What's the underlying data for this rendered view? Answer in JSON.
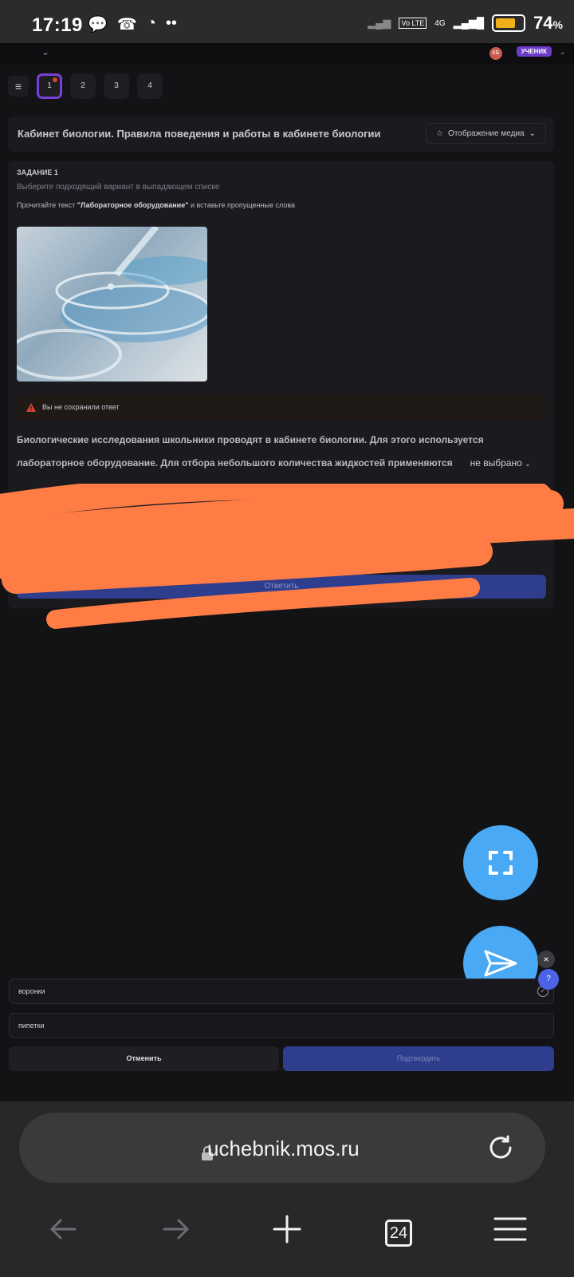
{
  "status_bar": {
    "time": "17:19",
    "battery": "74",
    "battery_unit": "%",
    "battery_level": 0.74,
    "network": "4G",
    "lte": "Vo LTE"
  },
  "header": {
    "avatar_initials": "КБ",
    "role": "УЧЕНИК"
  },
  "question_tabs": [
    "1",
    "2",
    "3",
    "4"
  ],
  "lesson": {
    "title": "Кабинет биологии. Правила поведения и работы в кабинете биологии",
    "media_button": "Отображение медиа"
  },
  "task": {
    "number": "ЗАДАНИЕ 1",
    "hint": "Выберите подходящий вариант в выпадающем списке",
    "instruction_prefix": "Прочитайте текст ",
    "instruction_bold": "\"Лабораторное оборудование\"",
    "instruction_suffix": " и вставьте пропущенные слова",
    "warning": "Вы не сохранили ответ",
    "body": "Биологические исследования школьники проводят в кабинете биологии. Для этого используется лабораторное оборудование. Для отбора небольшого количества жидкостей применяются",
    "select_value": "не выбрано",
    "answer_button": "Ответить"
  },
  "dropdown": {
    "options": [
      "воронки",
      "пипетки"
    ],
    "cancel": "Отменить",
    "confirm": "Подтвердить",
    "help": "?"
  },
  "browser": {
    "url": "uchebnik.mos.ru",
    "tab_count": "24"
  }
}
